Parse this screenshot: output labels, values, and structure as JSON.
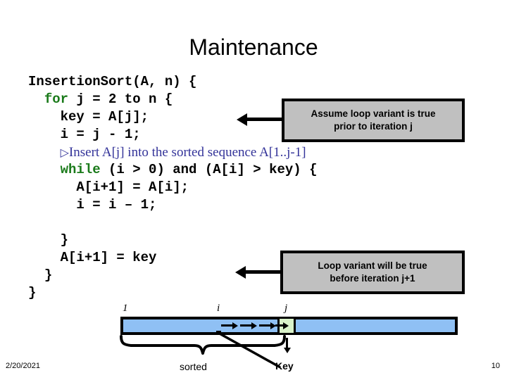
{
  "slide": {
    "title": "Maintenance",
    "footer_date": "2/20/2021",
    "page_number": "10"
  },
  "code": {
    "lines": [
      {
        "indent": 0,
        "parts": [
          {
            "text": "InsertionSort(A, n) {",
            "kind": "plain"
          }
        ]
      },
      {
        "indent": 1,
        "parts": [
          {
            "text": "for",
            "kind": "keyword"
          },
          {
            "text": " j = 2 to n {",
            "kind": "plain"
          }
        ]
      },
      {
        "indent": 2,
        "parts": [
          {
            "text": "key = A[j];",
            "kind": "plain"
          }
        ]
      },
      {
        "indent": 2,
        "parts": [
          {
            "text": "i = j - 1;",
            "kind": "plain"
          }
        ]
      },
      {
        "indent": 2,
        "parts": [
          {
            "text": "▷",
            "kind": "triangle"
          },
          {
            "text": "Insert A[j] into the sorted sequence A[1..j-1]",
            "kind": "comment"
          }
        ]
      },
      {
        "indent": 2,
        "parts": [
          {
            "text": "while",
            "kind": "keyword"
          },
          {
            "text": " (i > 0) and (A[i] > key) {",
            "kind": "plain"
          }
        ]
      },
      {
        "indent": 3,
        "parts": [
          {
            "text": "A[i+1] = A[i];",
            "kind": "plain"
          }
        ]
      },
      {
        "indent": 3,
        "parts": [
          {
            "text": "i = i – 1;",
            "kind": "plain"
          }
        ]
      },
      {
        "indent": 0,
        "parts": [
          {
            "text": "",
            "kind": "plain"
          }
        ]
      },
      {
        "indent": 2,
        "parts": [
          {
            "text": "}",
            "kind": "plain"
          }
        ]
      },
      {
        "indent": 2,
        "parts": [
          {
            "text": "A[i+1] = key",
            "kind": "plain"
          }
        ]
      },
      {
        "indent": 1,
        "parts": [
          {
            "text": "}",
            "kind": "plain"
          }
        ]
      },
      {
        "indent": 0,
        "parts": [
          {
            "text": "}",
            "kind": "plain"
          }
        ]
      }
    ],
    "keyword_color": "#1a7a1a",
    "comment_color": "#333399",
    "text_color": "#000000"
  },
  "callouts": {
    "top": {
      "line1": "Assume loop variant is true",
      "line2": "prior to iteration j",
      "fill": "#c0c0c0",
      "border": "#000000"
    },
    "bottom": {
      "line1": "Loop variant will be true",
      "line2": "before iteration j+1",
      "fill": "#c0c0c0",
      "border": "#000000"
    }
  },
  "diagram": {
    "index_labels": {
      "start": "1",
      "middle": "i",
      "key_pos": "j"
    },
    "bracket_label": "sorted",
    "key_label": "Key",
    "array_fill": "#8fc0f4",
    "key_fill": "#d9f2c9",
    "outline": "#000000",
    "shift_arrow_count": 4
  }
}
